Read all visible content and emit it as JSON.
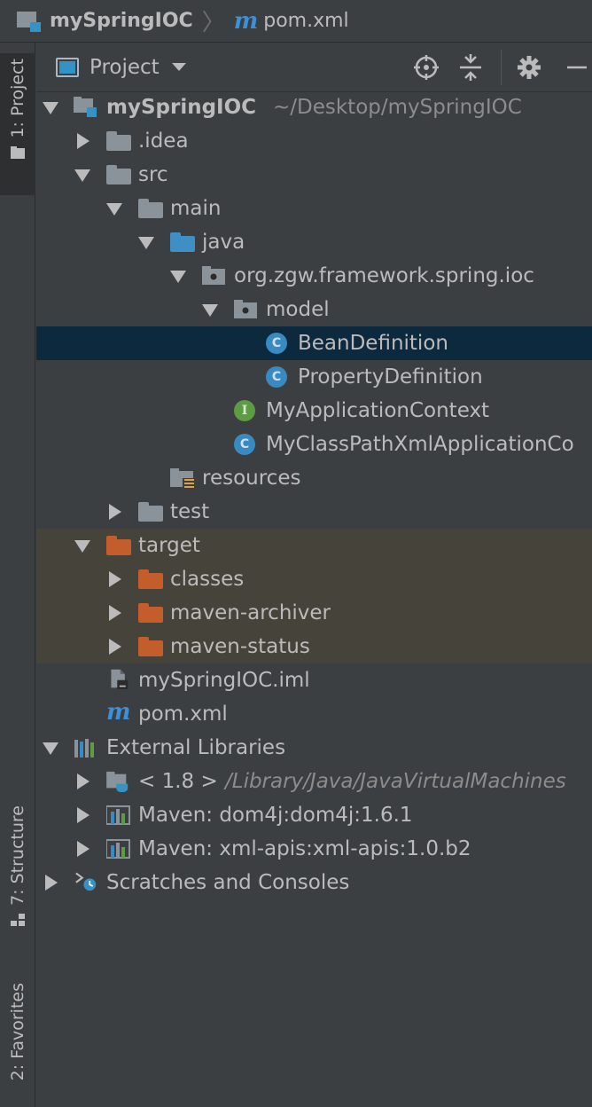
{
  "breadcrumb": {
    "project": "mySpringIOC",
    "file": "pom.xml"
  },
  "stripe": {
    "project_tab": "1: Project",
    "structure_tab": "7: Structure",
    "favorites_tab": "2: Favorites"
  },
  "header": {
    "title": "Project"
  },
  "tree": {
    "root_label": "mySpringIOC",
    "root_path": "~/Desktop/mySpringIOC",
    "idea": ".idea",
    "src": "src",
    "main": "main",
    "java": "java",
    "package": "org.zgw.framework.spring.ioc",
    "model": "model",
    "bean_definition": "BeanDefinition",
    "property_definition": "PropertyDefinition",
    "app_context": "MyApplicationContext",
    "classpath_context": "MyClassPathXmlApplicationCo",
    "resources": "resources",
    "test": "test",
    "target": "target",
    "classes": "classes",
    "maven_archiver": "maven-archiver",
    "maven_status": "maven-status",
    "iml": "mySpringIOC.iml",
    "pom": "pom.xml",
    "external_libraries": "External Libraries",
    "jdk": "< 1.8 >",
    "jdk_path": "/Library/Java/JavaVirtualMachines",
    "dom4j": "Maven: dom4j:dom4j:1.6.1",
    "xml_apis": "Maven: xml-apis:xml-apis:1.0.b2",
    "scratches": "Scratches and Consoles"
  },
  "colors": {
    "selection": "#0d293e",
    "excluded": "#45433a",
    "folder_blue": "#3f8fc4",
    "folder_orange": "#c35d2c"
  }
}
